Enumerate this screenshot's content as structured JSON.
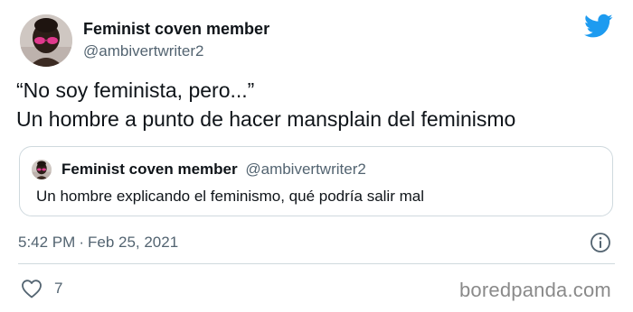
{
  "author": {
    "name": "Feminist coven member",
    "handle": "@ambivertwriter2"
  },
  "tweet": {
    "lines": [
      "“No soy feminista, pero...”",
      "Un hombre a punto de hacer mansplain del feminismo"
    ]
  },
  "quoted_tweet": {
    "name": "Feminist coven member",
    "handle": "@ambivertwriter2",
    "text": "Un hombre explicando el feminismo, qué podría salir mal"
  },
  "meta": {
    "time": "5:42 PM",
    "separator": "·",
    "date": "Feb 25, 2021"
  },
  "engagement": {
    "likes": "7"
  },
  "watermark": "boredpanda.com",
  "icons": {
    "brand": "twitter-bird-icon",
    "info": "info-icon",
    "like": "heart-icon"
  },
  "colors": {
    "twitter_blue": "#1d9bf0",
    "secondary_text": "#536471",
    "border": "#cfd9de",
    "avatar_glasses": "#e0398d"
  }
}
